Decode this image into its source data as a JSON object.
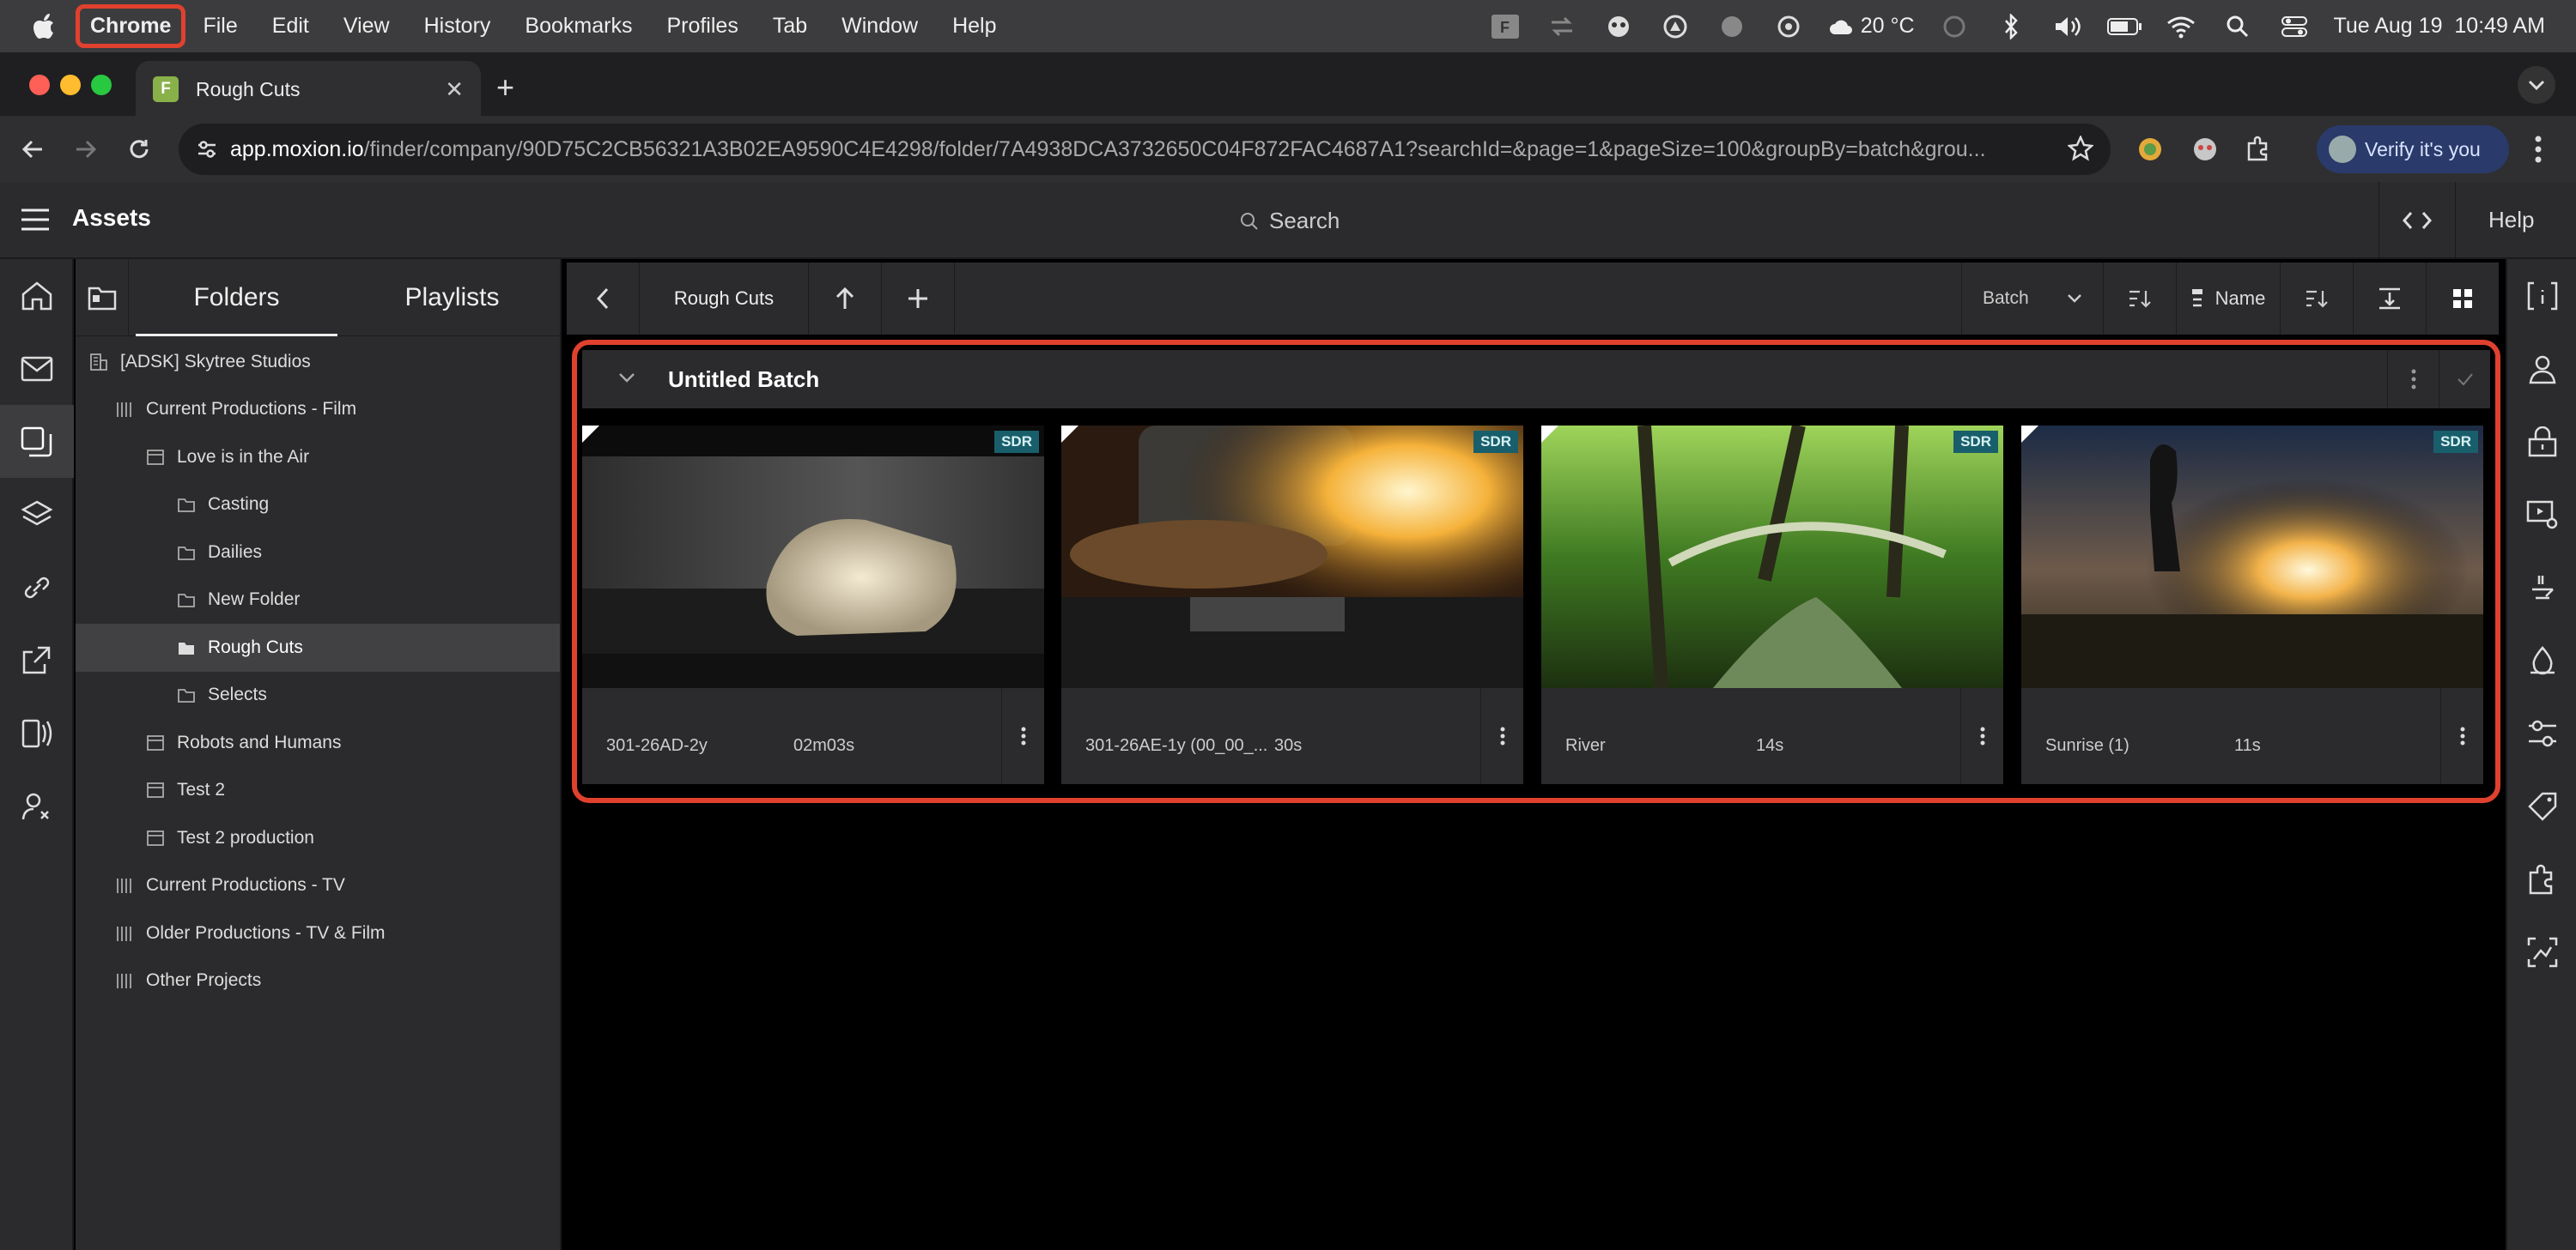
{
  "menubar": {
    "items": [
      "Chrome",
      "File",
      "Edit",
      "View",
      "History",
      "Bookmarks",
      "Profiles",
      "Tab",
      "Window",
      "Help"
    ],
    "weather": "20 °C",
    "datetime": "Tue Aug 19  10:49 AM"
  },
  "browser": {
    "tab_title": "Rough Cuts",
    "url_host": "app.moxion.io",
    "url_path": "/finder/company/90D75C2CB56321A3B02EA9590C4E4298/folder/7A4938DCA3732650C04F872FAC4687A1?searchId=&page=1&pageSize=100&groupBy=batch&grou...",
    "verify_label": "Verify it's you"
  },
  "app": {
    "title": "Assets",
    "search_placeholder": "Search",
    "help_label": "Help"
  },
  "panel": {
    "tabs": [
      "Folders",
      "Playlists"
    ],
    "tree": [
      {
        "label": "[ADSK] Skytree Studios",
        "level": 0,
        "icon": "building-icon"
      },
      {
        "label": "Current Productions - Film",
        "level": 1,
        "icon": "library-icon"
      },
      {
        "label": "Love is in the Air",
        "level": 2,
        "icon": "project-icon"
      },
      {
        "label": "Casting",
        "level": 3,
        "icon": "folder-icon"
      },
      {
        "label": "Dailies",
        "level": 3,
        "icon": "folder-icon"
      },
      {
        "label": "New Folder",
        "level": 3,
        "icon": "folder-icon"
      },
      {
        "label": "Rough Cuts",
        "level": 3,
        "icon": "folder-filled-icon",
        "selected": true
      },
      {
        "label": "Selects",
        "level": 3,
        "icon": "folder-icon"
      },
      {
        "label": "Robots and Humans",
        "level": 2,
        "icon": "project-icon"
      },
      {
        "label": "Test 2",
        "level": 2,
        "icon": "project-icon"
      },
      {
        "label": "Test 2 production",
        "level": 2,
        "icon": "project-icon"
      },
      {
        "label": "Current Productions - TV",
        "level": 1,
        "icon": "library-icon"
      },
      {
        "label": "Older Productions - TV & Film",
        "level": 1,
        "icon": "library-icon"
      },
      {
        "label": "Other Projects",
        "level": 1,
        "icon": "library-icon"
      }
    ]
  },
  "toolbar": {
    "breadcrumb": "Rough Cuts",
    "group_by": "Batch",
    "sort_by": "Name"
  },
  "batch": {
    "title": "Untitled Batch",
    "assets": [
      {
        "name": "301-26AD-2y",
        "duration": "02m03s",
        "badge": "SDR"
      },
      {
        "name": "301-26AE-1y (00_00_...",
        "duration": "30s",
        "badge": "SDR"
      },
      {
        "name": "River",
        "duration": "14s",
        "badge": "SDR"
      },
      {
        "name": "Sunrise (1)",
        "duration": "11s",
        "badge": "SDR"
      }
    ]
  },
  "colors": {
    "accent_highlight": "#e0412e",
    "sdr_badge": "#195e6b",
    "panel": "#2b2b2d"
  }
}
